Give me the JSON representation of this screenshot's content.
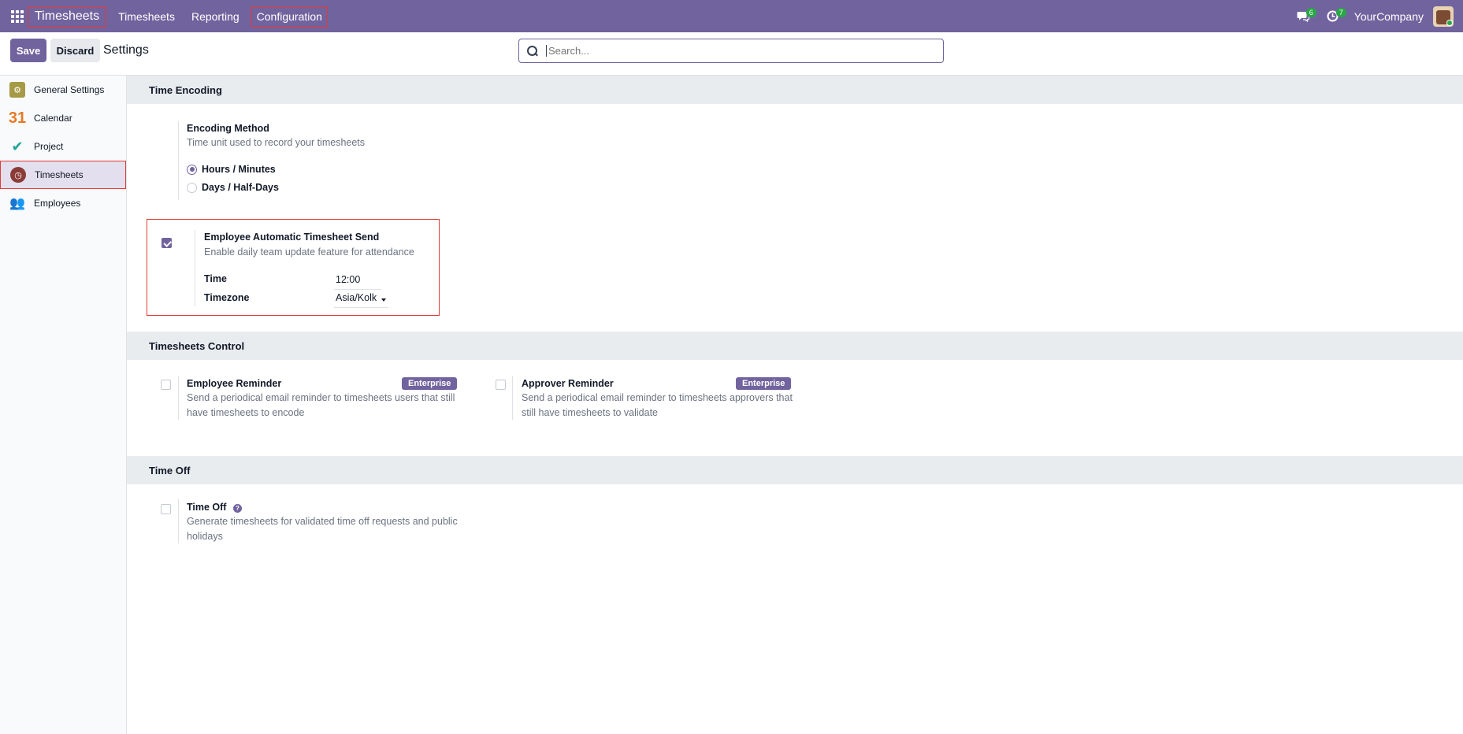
{
  "navbar": {
    "brand": "Timesheets",
    "menu": [
      "Timesheets",
      "Reporting",
      "Configuration"
    ],
    "messages_count": "6",
    "activities_count": "7",
    "company": "YourCompany"
  },
  "control": {
    "save_label": "Save",
    "discard_label": "Discard",
    "title": "Settings",
    "search_placeholder": "Search..."
  },
  "sidebar": {
    "items": [
      {
        "label": "General Settings",
        "icon": "gear-icon"
      },
      {
        "label": "Calendar",
        "icon": "calendar-icon",
        "glyph": "31"
      },
      {
        "label": "Project",
        "icon": "project-check-icon"
      },
      {
        "label": "Timesheets",
        "icon": "stopwatch-icon",
        "active": true
      },
      {
        "label": "Employees",
        "icon": "employees-icon"
      }
    ]
  },
  "sections": {
    "time_encoding": {
      "title": "Time Encoding",
      "encoding_method": {
        "title": "Encoding Method",
        "desc": "Time unit used to record your timesheets",
        "options": [
          "Hours / Minutes",
          "Days / Half-Days"
        ],
        "selected": "Hours / Minutes"
      },
      "auto_send": {
        "title": "Employee Automatic Timesheet Send",
        "desc": "Enable daily team update feature for attendance",
        "checked": true,
        "time_label": "Time",
        "time_value": "12:00",
        "timezone_label": "Timezone",
        "timezone_value": "Asia/Kolk"
      }
    },
    "timesheets_control": {
      "title": "Timesheets Control",
      "employee_reminder": {
        "title": "Employee Reminder",
        "badge": "Enterprise",
        "desc_line1": "Send a periodical email reminder to timesheets users that still",
        "desc_line2": "have timesheets to encode"
      },
      "approver_reminder": {
        "title": "Approver Reminder",
        "badge": "Enterprise",
        "desc_line1": "Send a periodical email reminder to timesheets approvers that",
        "desc_line2": "still have timesheets to validate"
      }
    },
    "time_off": {
      "title": "Time Off",
      "setting": {
        "title": "Time Off",
        "desc_line1": "Generate timesheets for validated time off requests and public",
        "desc_line2": "holidays"
      }
    }
  },
  "colors": {
    "brand": "#71639e",
    "highlight": "#e53935",
    "badge_green": "#28a745"
  }
}
